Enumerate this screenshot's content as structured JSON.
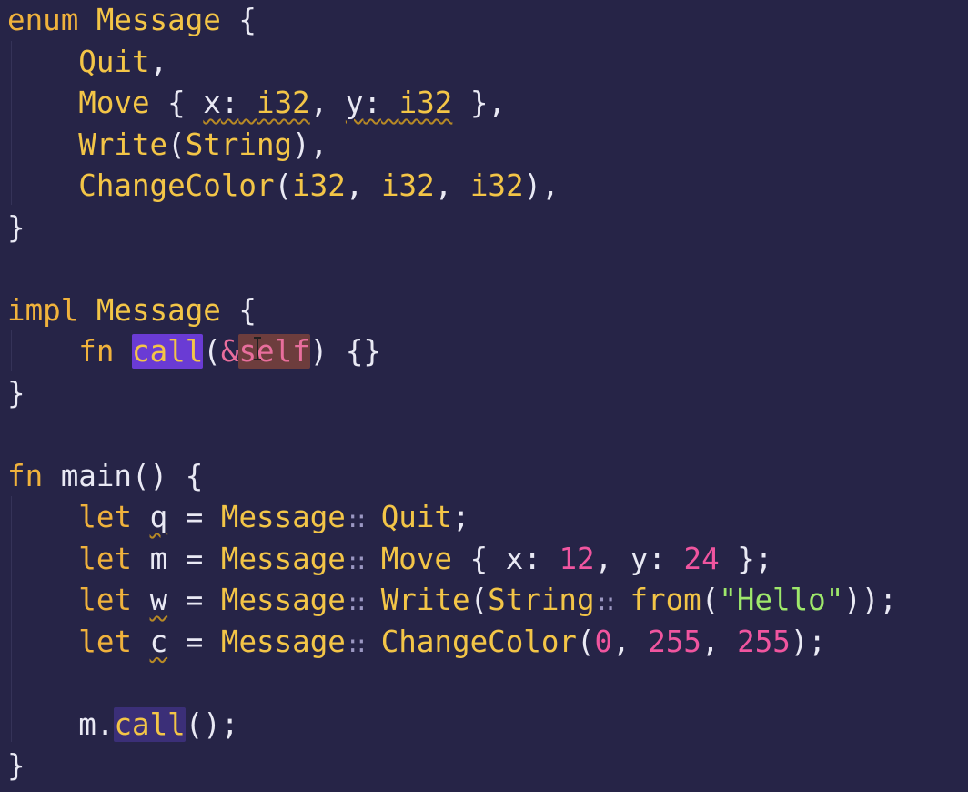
{
  "editor": {
    "language": "rust",
    "theme": {
      "background": "#262447",
      "keyword": "#f0b23c",
      "type": "#f3c547",
      "number": "#f0559f",
      "string": "#9ee86b",
      "text": "#e9e9f4",
      "selection_highlight": "#6a3bd4",
      "reference_highlight": "#6d3d3d"
    },
    "tokens": {
      "enum": "enum",
      "message": "Message",
      "open_brace": "{",
      "close_brace": "}",
      "quit": "Quit",
      "move": "Move",
      "x": "x",
      "y": "y",
      "i32": "i32",
      "write": "Write",
      "string": "String",
      "change_color": "ChangeColor",
      "impl": "impl",
      "fn": "fn",
      "call": "call",
      "amp_self": "&self",
      "main": "main",
      "let": "let",
      "q": "q",
      "m": "m",
      "w": "w",
      "c": "c",
      "path_sep": "::",
      "from": "from",
      "hello": "\"Hello\"",
      "n12": "12",
      "n24": "24",
      "n0": "0",
      "n255a": "255",
      "n255b": "255"
    }
  }
}
